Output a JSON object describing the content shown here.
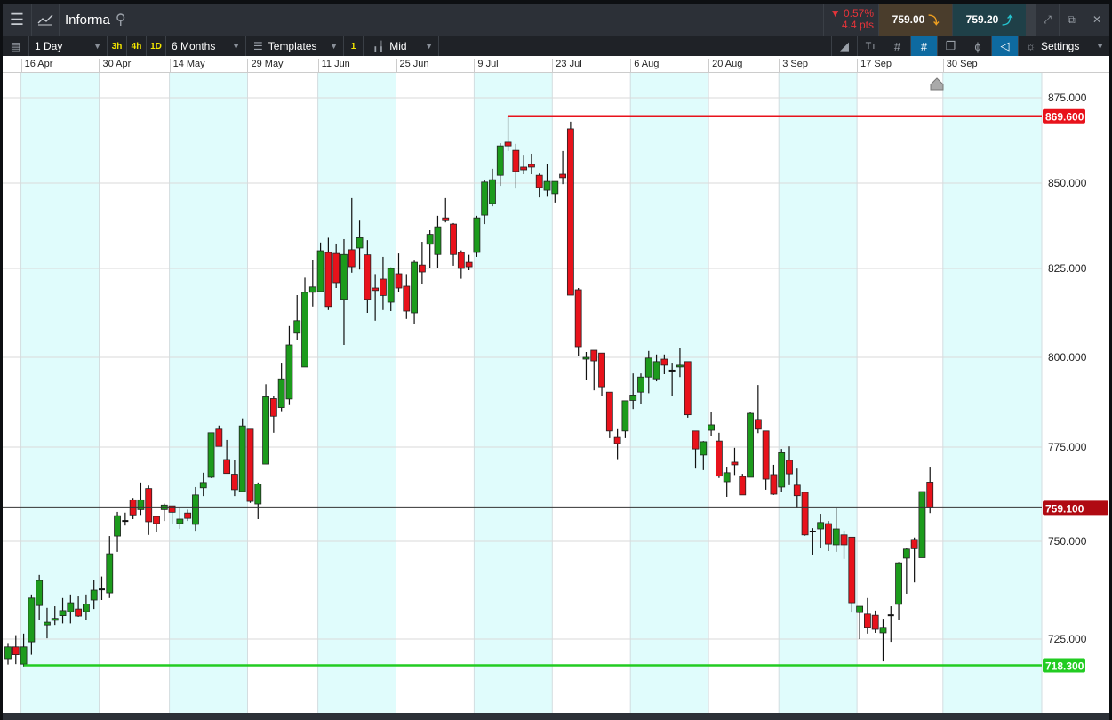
{
  "header": {
    "title": "Informa",
    "change_pct": "▼ 0.57%",
    "change_pts": "4.4 pts",
    "sell": "759.00",
    "buy": "759.20"
  },
  "toolbar": {
    "interval": "1 Day",
    "q3h": "3h",
    "q4h": "4h",
    "q1d": "1D",
    "range": "6 Months",
    "templates": "Templates",
    "one": "1",
    "price_type": "Mid",
    "settings": "Settings"
  },
  "colors": {
    "up": "#1c9b1c",
    "down": "#e8121b",
    "resistance": "#e8121b",
    "support": "#22cc22",
    "accent": "#0e6aa0"
  },
  "chart_data": {
    "type": "candlestick",
    "x_labels": [
      {
        "label": "16 Apr",
        "index": 2
      },
      {
        "label": "30 Apr",
        "index": 12
      },
      {
        "label": "14 May",
        "index": 21
      },
      {
        "label": "29 May",
        "index": 31
      },
      {
        "label": "11 Jun",
        "index": 40
      },
      {
        "label": "25 Jun",
        "index": 50
      },
      {
        "label": "9 Jul",
        "index": 60
      },
      {
        "label": "23 Jul",
        "index": 70
      },
      {
        "label": "6 Aug",
        "index": 80
      },
      {
        "label": "20 Aug",
        "index": 90
      },
      {
        "label": "3 Sep",
        "index": 99
      },
      {
        "label": "17 Sep",
        "index": 109
      },
      {
        "label": "30 Sep",
        "index": 120
      }
    ],
    "y_ticks": [
      "875.000",
      "850.000",
      "825.000",
      "800.000",
      "775.000",
      "750.000",
      "725.000"
    ],
    "current_price": 759.1,
    "current_label": "759.100",
    "resistance": {
      "value": 869.6,
      "label": "869.600",
      "start_index": 64
    },
    "support": {
      "value": 718.3,
      "label": "718.300",
      "start_index": 2
    },
    "ohlc": [
      [
        720,
        724,
        718.5,
        723
      ],
      [
        723,
        726,
        718.6,
        721
      ],
      [
        718.6,
        726.4,
        718,
        723
      ],
      [
        724.3,
        736.4,
        721,
        735.5
      ],
      [
        733.6,
        741.4,
        730,
        740
      ],
      [
        728.6,
        733,
        725.2,
        729.3
      ],
      [
        729.8,
        733.4,
        728.6,
        730.3
      ],
      [
        731,
        735.5,
        729,
        732.3
      ],
      [
        732,
        736.4,
        729,
        734.3
      ],
      [
        732.7,
        735.9,
        730.7,
        730.9
      ],
      [
        732,
        736.4,
        729.8,
        734
      ],
      [
        735,
        740,
        732.7,
        737.5
      ],
      [
        737.7,
        741,
        735,
        737.7
      ],
      [
        736.8,
        751.4,
        735.5,
        746.8
      ],
      [
        751.4,
        757.8,
        747.3,
        756.8
      ],
      [
        755.4,
        757.6,
        754.2,
        755.4
      ],
      [
        761,
        761.5,
        755.9,
        757
      ],
      [
        758.4,
        765.6,
        757,
        761
      ],
      [
        764,
        764.8,
        751.7,
        755.2
      ],
      [
        756.6,
        756.8,
        752.5,
        754.7
      ],
      [
        758.4,
        760,
        755.4,
        759.6
      ],
      [
        759.4,
        759.4,
        754.5,
        757.7
      ],
      [
        754.7,
        759,
        753.3,
        755.9
      ],
      [
        757.5,
        758.4,
        755.4,
        756.1
      ],
      [
        754.5,
        764.4,
        752.8,
        762.3
      ],
      [
        764.2,
        768.2,
        762,
        765.6
      ],
      [
        767,
        779,
        766.8,
        779
      ],
      [
        780,
        781,
        776,
        775.2
      ],
      [
        771.7,
        777,
        768,
        768
      ],
      [
        767.8,
        771.7,
        762,
        763.7
      ],
      [
        763.2,
        783,
        763.2,
        780.9
      ],
      [
        780,
        780,
        760.2,
        760.6
      ],
      [
        759.9,
        765.6,
        755.9,
        765.2
      ],
      [
        770.5,
        792.5,
        770.5,
        789
      ],
      [
        788.5,
        789.3,
        779,
        783.6
      ],
      [
        786,
        798.5,
        785,
        794
      ],
      [
        788.4,
        808.8,
        786.7,
        803.5
      ],
      [
        806.8,
        817.5,
        805,
        810.3
      ],
      [
        797.3,
        822.4,
        797.3,
        818.3
      ],
      [
        818.3,
        827.6,
        814.3,
        819.8
      ],
      [
        818.5,
        832.6,
        818.5,
        830.2
      ],
      [
        829.7,
        834,
        813.3,
        814.3
      ],
      [
        829.4,
        832.3,
        819.5,
        821
      ],
      [
        816.3,
        833.6,
        803.5,
        829.1
      ],
      [
        830.5,
        845.6,
        823.8,
        825.5
      ],
      [
        831,
        839,
        824.7,
        834
      ],
      [
        829,
        833.3,
        812.5,
        816.3
      ],
      [
        819.5,
        823.4,
        810.3,
        818.8
      ],
      [
        822,
        828.4,
        813.3,
        817.4
      ],
      [
        815.5,
        825.3,
        813,
        825
      ],
      [
        823.5,
        829.4,
        818.3,
        819.5
      ],
      [
        820,
        823.4,
        810.8,
        813
      ],
      [
        812.5,
        827.3,
        809.3,
        826.8
      ],
      [
        826,
        832.8,
        820.5,
        824
      ],
      [
        832.1,
        836.2,
        825,
        835
      ],
      [
        829.1,
        840.4,
        825,
        837.2
      ],
      [
        839.8,
        845.6,
        838.5,
        839
      ],
      [
        838,
        838.3,
        825.8,
        829.1
      ],
      [
        829.7,
        830.3,
        822.1,
        825
      ],
      [
        826.8,
        829,
        824.5,
        825.5
      ],
      [
        829.7,
        840.4,
        828.4,
        839.8
      ],
      [
        840.6,
        851,
        838,
        850.3
      ],
      [
        844,
        854.2,
        843.2,
        851
      ],
      [
        852.3,
        861.7,
        849.2,
        860.9
      ],
      [
        862,
        869.6,
        859.4,
        860.9
      ],
      [
        859.6,
        861.5,
        848.4,
        853.4
      ],
      [
        854.7,
        858.3,
        852.6,
        853.9
      ],
      [
        855.5,
        858.6,
        852.6,
        854.7
      ],
      [
        852.3,
        852.8,
        845.8,
        848.7
      ],
      [
        847.9,
        855.5,
        846,
        850.5
      ],
      [
        846.9,
        850.5,
        844.3,
        850.5
      ],
      [
        852.6,
        859.4,
        849.7,
        851.6
      ],
      [
        865.9,
        868,
        817.5,
        817.5
      ],
      [
        819,
        819.5,
        800.5,
        803
      ],
      [
        799.5,
        801.5,
        793.6,
        800
      ],
      [
        802,
        802,
        790.8,
        799
      ],
      [
        801.2,
        801.2,
        789.3,
        791.8
      ],
      [
        790.3,
        790.3,
        777.5,
        779.5
      ],
      [
        777.7,
        780,
        771.8,
        776
      ],
      [
        779.5,
        787.9,
        777.5,
        787.9
      ],
      [
        788,
        795.5,
        785.6,
        789.5
      ],
      [
        790.3,
        795.5,
        787,
        794.5
      ],
      [
        794.5,
        801.8,
        790,
        799.8
      ],
      [
        794,
        800.8,
        793.3,
        798.8
      ],
      [
        799.5,
        800.8,
        795.3,
        797.8
      ],
      [
        796.3,
        798.5,
        789.3,
        796.3
      ],
      [
        797.3,
        802.5,
        794.5,
        797.8
      ],
      [
        798.8,
        798.8,
        783.2,
        784
      ],
      [
        779.5,
        779.5,
        769.3,
        774.5
      ],
      [
        772.9,
        776.7,
        768.9,
        776.5
      ],
      [
        779.7,
        784.9,
        778,
        781.2
      ],
      [
        776.7,
        779,
        766.8,
        767.3
      ],
      [
        765.8,
        769.8,
        761.8,
        768.2
      ],
      [
        771,
        774.8,
        767.6,
        770.3
      ],
      [
        767.2,
        767.9,
        762.3,
        762.3
      ],
      [
        767,
        784.9,
        767,
        784.4
      ],
      [
        782.7,
        792.3,
        778.9,
        780
      ],
      [
        779.5,
        779.5,
        763.7,
        766.5
      ],
      [
        767.7,
        770.3,
        762.3,
        762.5
      ],
      [
        764.4,
        774.5,
        763.2,
        773.5
      ],
      [
        771.5,
        775.2,
        764.9,
        767.9
      ],
      [
        764.9,
        769.3,
        759,
        762.1
      ],
      [
        763,
        763,
        751.5,
        751.7
      ],
      [
        752.6,
        753.5,
        746.6,
        752.6
      ],
      [
        753.3,
        757.3,
        748.4,
        755
      ],
      [
        754.7,
        755.4,
        747.5,
        749.3
      ],
      [
        749.1,
        759,
        747.3,
        753.3
      ],
      [
        751.7,
        752.8,
        745.5,
        749.1
      ],
      [
        751.1,
        751.1,
        731.8,
        734.3
      ],
      [
        731.8,
        733.4,
        725,
        733.4
      ],
      [
        731.4,
        735.5,
        726.4,
        728
      ],
      [
        731.1,
        732.3,
        726.6,
        727.5
      ],
      [
        726.6,
        730.2,
        719.3,
        728
      ],
      [
        731.1,
        733.4,
        724.3,
        731.1
      ],
      [
        733.9,
        744.7,
        730,
        744.5
      ],
      [
        745.7,
        748.2,
        736.6,
        748
      ],
      [
        750.5,
        751,
        739.5,
        748.1
      ],
      [
        745.8,
        763.2,
        745.8,
        763.2
      ],
      [
        765.7,
        769.8,
        757.5,
        759.1
      ]
    ]
  }
}
